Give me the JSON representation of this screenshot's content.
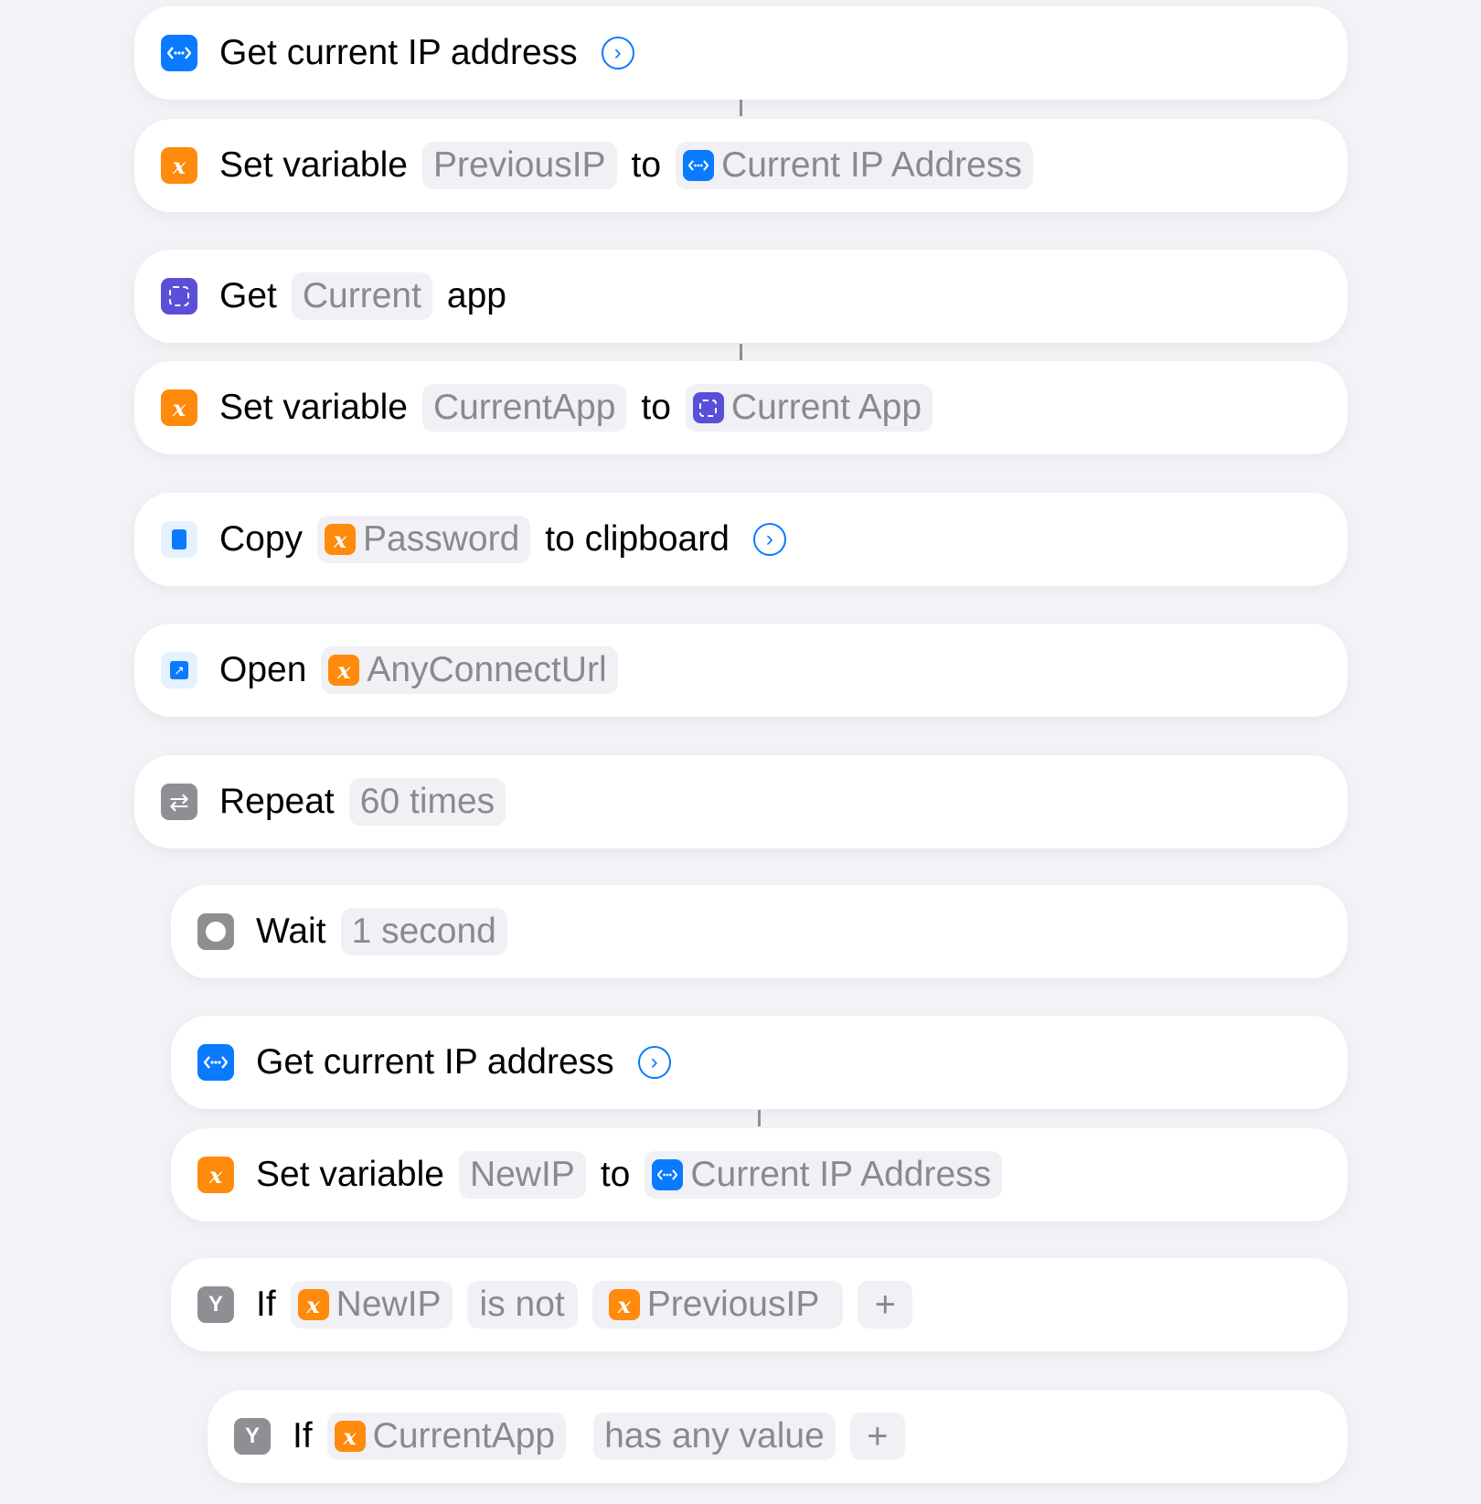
{
  "actions": [
    {
      "verb": "Get current IP address"
    },
    {
      "verb": "Set variable",
      "var": "PreviousIP",
      "to": "to",
      "value": "Current IP Address"
    },
    {
      "verb": "Get",
      "param": "Current",
      "suffix": "app"
    },
    {
      "verb": "Set variable",
      "var": "CurrentApp",
      "to": "to",
      "value": "Current App"
    },
    {
      "verb": "Copy",
      "var": "Password",
      "suffix": "to clipboard"
    },
    {
      "verb": "Open",
      "var": "AnyConnectUrl"
    },
    {
      "verb": "Repeat",
      "param": "60 times"
    },
    {
      "verb": "Wait",
      "param": "1 second"
    },
    {
      "verb": "Get current IP address"
    },
    {
      "verb": "Set variable",
      "var": "NewIP",
      "to": "to",
      "value": "Current IP Address"
    },
    {
      "verb": "If",
      "var": "NewIP",
      "cond": "is not",
      "var2": "PreviousIP",
      "plus": "+"
    },
    {
      "verb": "If",
      "var": "CurrentApp",
      "cond": "has any value",
      "plus": "+"
    }
  ],
  "icons": {
    "x": "x",
    "chevron": "›"
  },
  "colors": {
    "blue": "#0a7aff",
    "orange": "#ff8a0c",
    "indigo": "#5a4fd8",
    "gray": "#8e8e93"
  }
}
